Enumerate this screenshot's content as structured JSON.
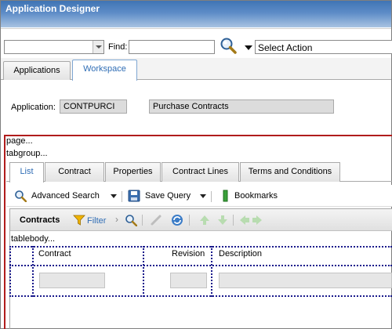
{
  "window": {
    "title": "Application Designer"
  },
  "toolbar": {
    "find_label": "Find:",
    "find_value": "",
    "select_action": "Select Action"
  },
  "top_tabs": [
    {
      "label": "Applications",
      "active": false
    },
    {
      "label": "Workspace",
      "active": true
    }
  ],
  "application": {
    "label": "Application:",
    "value": "CONTPURCI",
    "description": "Purchase Contracts"
  },
  "designer": {
    "page_marker": "page...",
    "tabgroup_marker": "tabgroup...",
    "tablebody_marker": "tablebody..."
  },
  "inner_tabs": [
    {
      "label": "List",
      "active": true
    },
    {
      "label": "Contract",
      "active": false
    },
    {
      "label": "Properties",
      "active": false
    },
    {
      "label": "Contract Lines",
      "active": false
    },
    {
      "label": "Terms and Conditions",
      "active": false
    }
  ],
  "actions": {
    "advanced_search": "Advanced Search",
    "save_query": "Save Query",
    "bookmarks": "Bookmarks"
  },
  "table": {
    "title": "Contracts",
    "filter_label": "Filter",
    "columns": [
      "Contract",
      "Revision",
      "Description"
    ]
  },
  "colors": {
    "accent": "#2f6db5",
    "page_border": "#b01c1c",
    "grid_dots": "#1a1a8c",
    "title_bar": "#3f74b4"
  }
}
